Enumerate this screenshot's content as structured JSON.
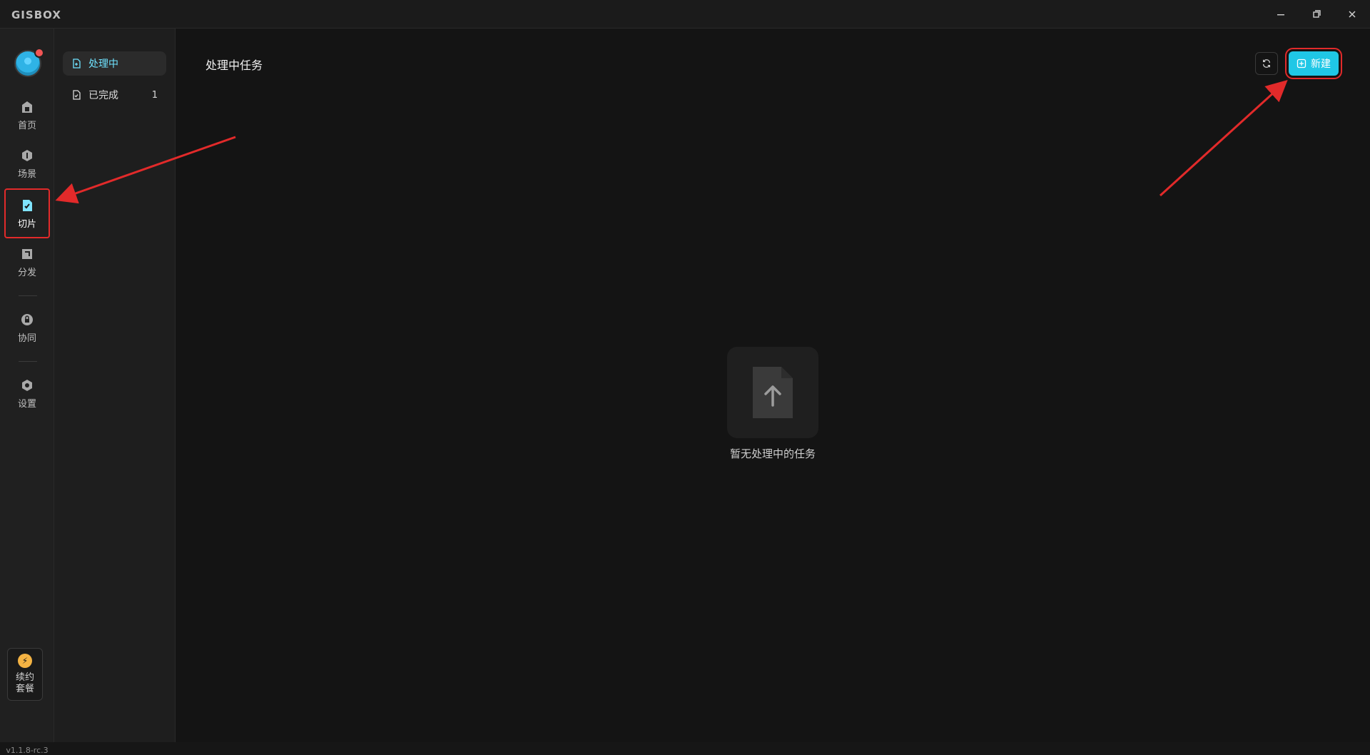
{
  "app": {
    "brand": "GISBOX"
  },
  "window": {
    "minimize": "—",
    "restore": "❐",
    "close": "✕"
  },
  "rail": {
    "items": [
      {
        "label": "首页",
        "icon": "home-icon"
      },
      {
        "label": "场景",
        "icon": "scene-icon"
      },
      {
        "label": "切片",
        "icon": "tiles-icon",
        "active": true
      },
      {
        "label": "分发",
        "icon": "distribute-icon"
      },
      {
        "label": "协同",
        "icon": "lock-icon"
      },
      {
        "label": "设置",
        "icon": "gear-icon"
      }
    ],
    "plan": {
      "line1": "续约",
      "line2": "套餐"
    },
    "version": "v1.1.8-rc.3"
  },
  "subnav": {
    "items": [
      {
        "label": "处理中",
        "active": true,
        "count": ""
      },
      {
        "label": "已完成",
        "active": false,
        "count": "1"
      }
    ]
  },
  "main": {
    "title": "处理中任务",
    "new_button": "新建",
    "empty_text": "暂无处理中的任务"
  },
  "colors": {
    "accent": "#1fc7e6",
    "annotation_red": "#e22a2a"
  }
}
